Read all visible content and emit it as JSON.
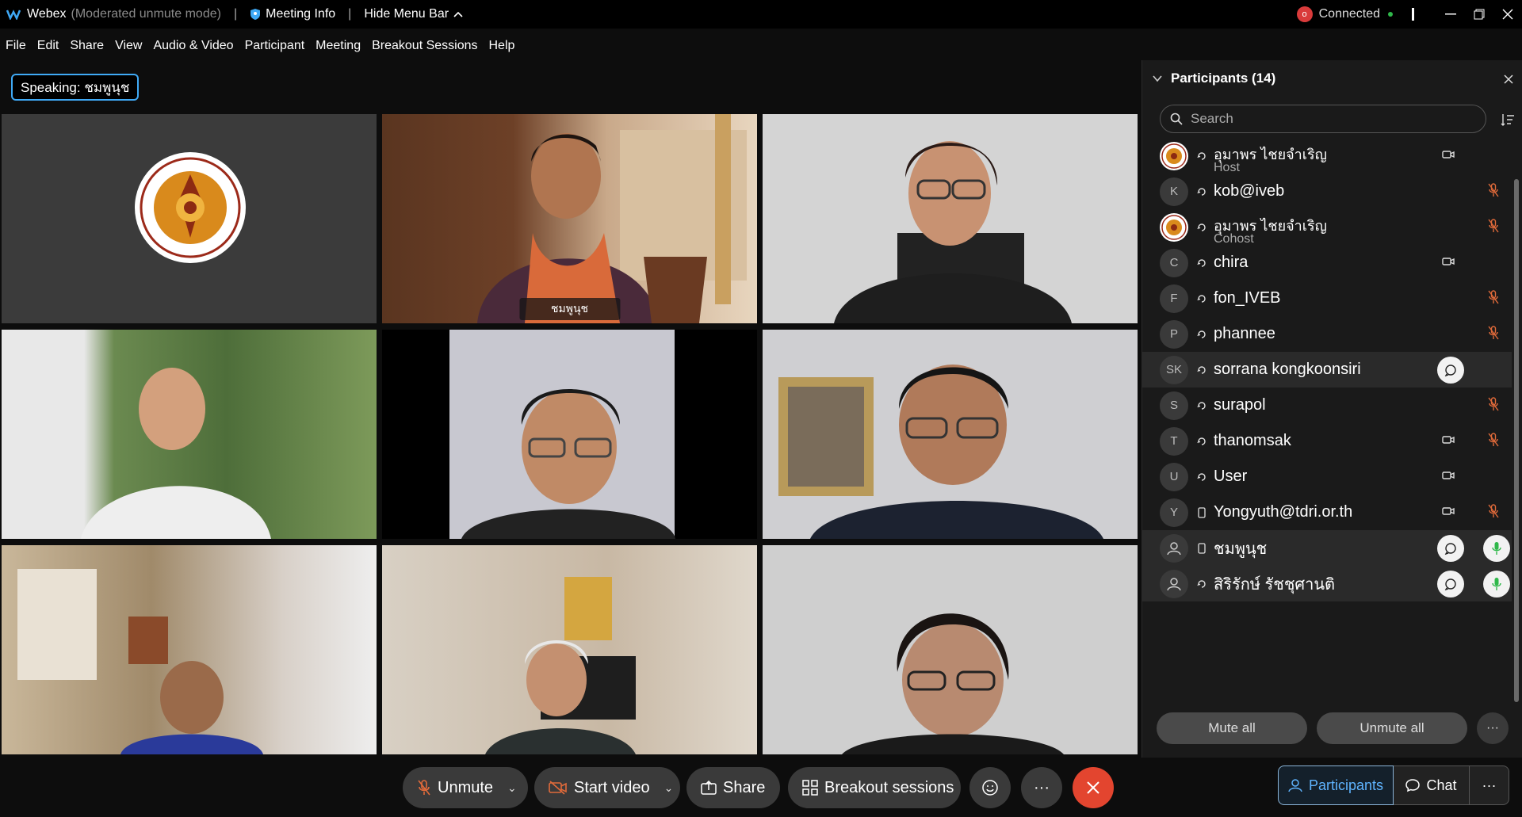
{
  "titlebar": {
    "app_name": "Webex",
    "mode": "(Moderated unmute mode)",
    "separator": "|",
    "meeting_info": "Meeting Info",
    "hide_menu_bar": "Hide Menu Bar",
    "connection_status": "Connected",
    "connection_icon_letter": "o"
  },
  "menu": {
    "items": [
      "File",
      "Edit",
      "Share",
      "View",
      "Audio & Video",
      "Participant",
      "Meeting",
      "Breakout Sessions",
      "Help"
    ]
  },
  "speaking_badge": "Speaking: ชมพูนุช",
  "video_grid": {
    "active_speaker_name": "ชมพูนุช"
  },
  "participants_panel": {
    "title": "Participants (14)",
    "search_placeholder": "Search",
    "participants": [
      {
        "initials": "",
        "name": "อุมาพร ไชยจำเริญ",
        "role": "Host",
        "video": true,
        "mic": "none",
        "avatar": "logo"
      },
      {
        "initials": "K",
        "name": "kob@iveb",
        "role": "",
        "video": false,
        "mic": "off",
        "avatar": "initials"
      },
      {
        "initials": "",
        "name": "อุมาพร ไชยจำเริญ",
        "role": "Cohost",
        "video": false,
        "mic": "off",
        "avatar": "logo"
      },
      {
        "initials": "C",
        "name": "chira",
        "role": "",
        "video": true,
        "mic": "none",
        "avatar": "initials"
      },
      {
        "initials": "F",
        "name": "fon_IVEB",
        "role": "",
        "video": false,
        "mic": "off",
        "avatar": "initials"
      },
      {
        "initials": "P",
        "name": "phannee",
        "role": "",
        "video": false,
        "mic": "off",
        "avatar": "initials"
      },
      {
        "initials": "SK",
        "name": "sorrana kongkoonsiri",
        "role": "",
        "video": false,
        "mic": "chat",
        "avatar": "initials"
      },
      {
        "initials": "S",
        "name": "surapol",
        "role": "",
        "video": false,
        "mic": "off",
        "avatar": "initials"
      },
      {
        "initials": "T",
        "name": "thanomsak",
        "role": "",
        "video": true,
        "mic": "off",
        "avatar": "initials"
      },
      {
        "initials": "U",
        "name": "User",
        "role": "",
        "video": true,
        "mic": "none",
        "avatar": "initials"
      },
      {
        "initials": "Y",
        "name": "Yongyuth@tdri.or.th",
        "role": "",
        "video": true,
        "mic": "off",
        "avatar": "initials"
      },
      {
        "initials": "",
        "name": "ชมพูนุช",
        "role": "",
        "video": false,
        "mic": "chat-on",
        "avatar": "person"
      },
      {
        "initials": "",
        "name": "สิริรักษ์ รัชชุศานติ",
        "role": "",
        "video": false,
        "mic": "chat-on",
        "avatar": "person"
      }
    ],
    "mute_all": "Mute all",
    "unmute_all": "Unmute all",
    "more": "···"
  },
  "toolbar": {
    "unmute": "Unmute",
    "start_video": "Start video",
    "share": "Share",
    "breakout_sessions": "Breakout sessions",
    "more": "···",
    "participants_tab": "Participants",
    "chat_tab": "Chat",
    "more_tab": "···"
  },
  "colors": {
    "accent_blue": "#1ea7ff",
    "leave_red": "#e3452f",
    "muted_red": "#e06a3a",
    "unmuted_green": "#2fb84a"
  }
}
